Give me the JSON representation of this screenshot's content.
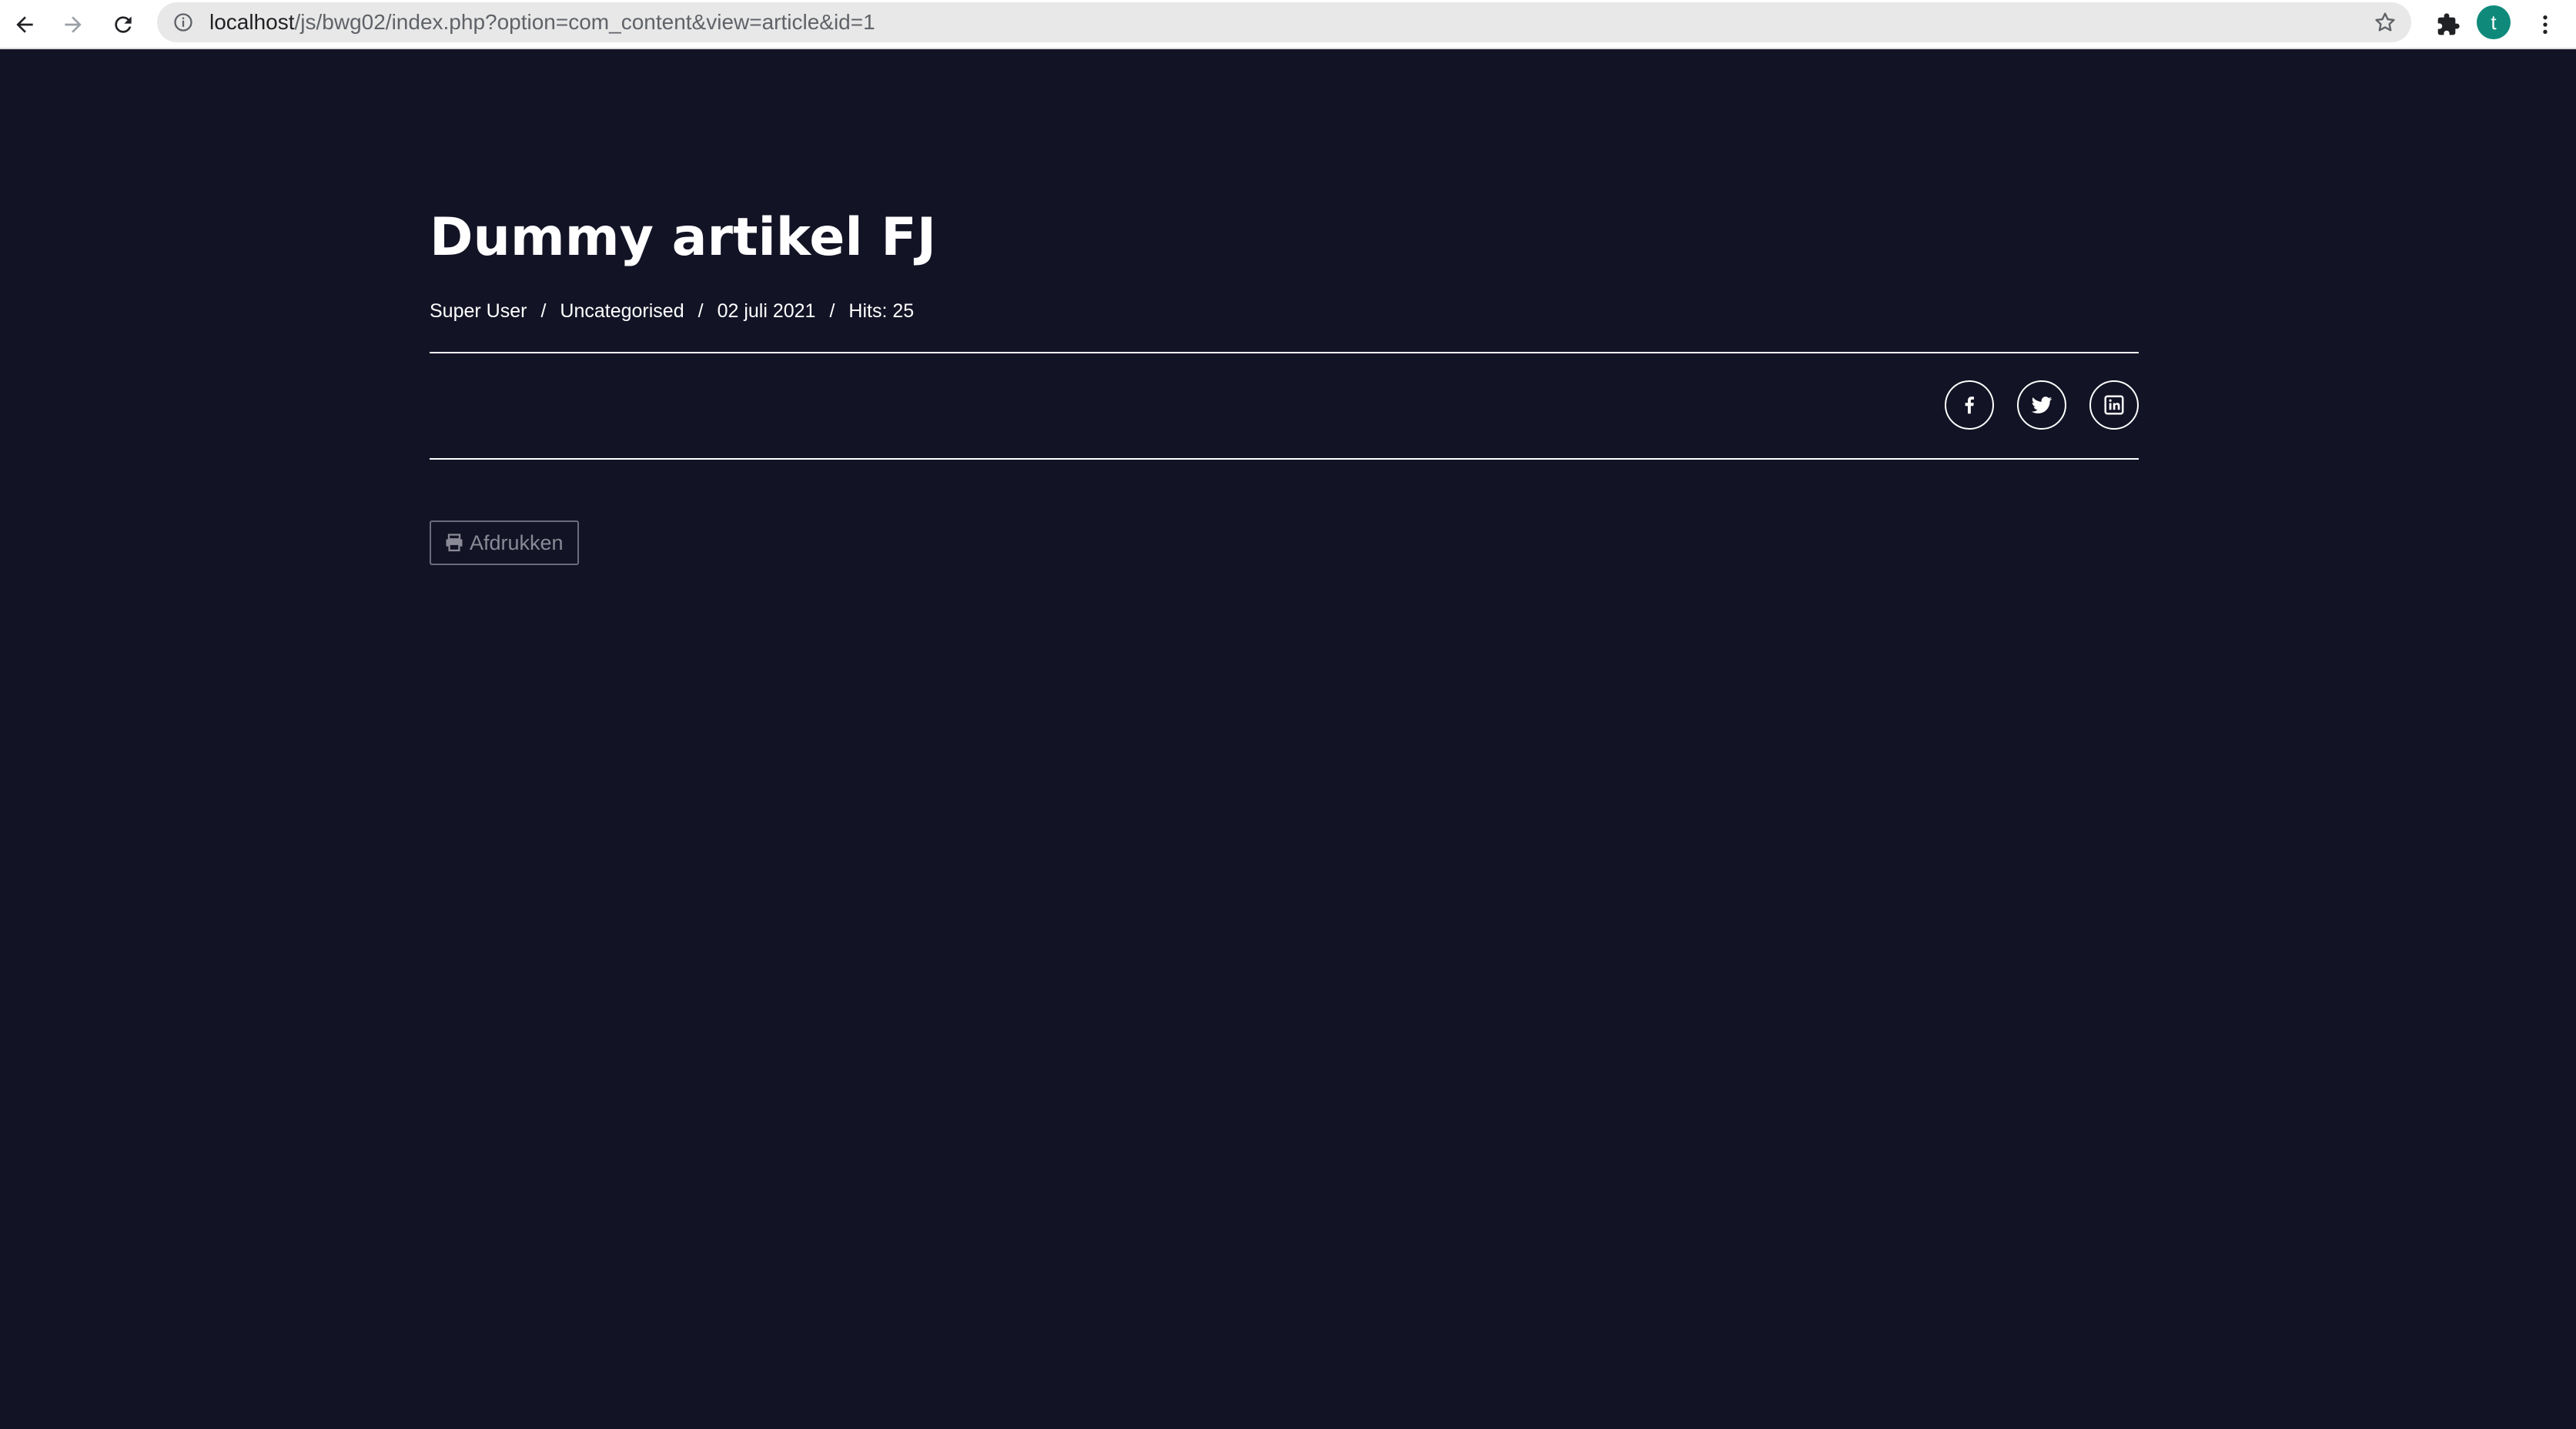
{
  "browser": {
    "url_host": "localhost",
    "url_path": "/js/bwg02/index.php?option=com_content&view=article&id=1",
    "avatar_letter": "t",
    "avatar_color": "#0f8a7a"
  },
  "article": {
    "title": "Dummy artikel FJ",
    "meta": {
      "author": "Super User",
      "category": "Uncategorised",
      "date": "02 juli 2021",
      "hits": "Hits: 25",
      "separator": "/"
    },
    "share": {
      "icons": [
        "facebook-icon",
        "twitter-icon",
        "linkedin-icon"
      ]
    },
    "print_label": "Afdrukken"
  },
  "colors": {
    "background": "#131326",
    "text": "#ffffff",
    "muted_button": "#8a8a96"
  }
}
